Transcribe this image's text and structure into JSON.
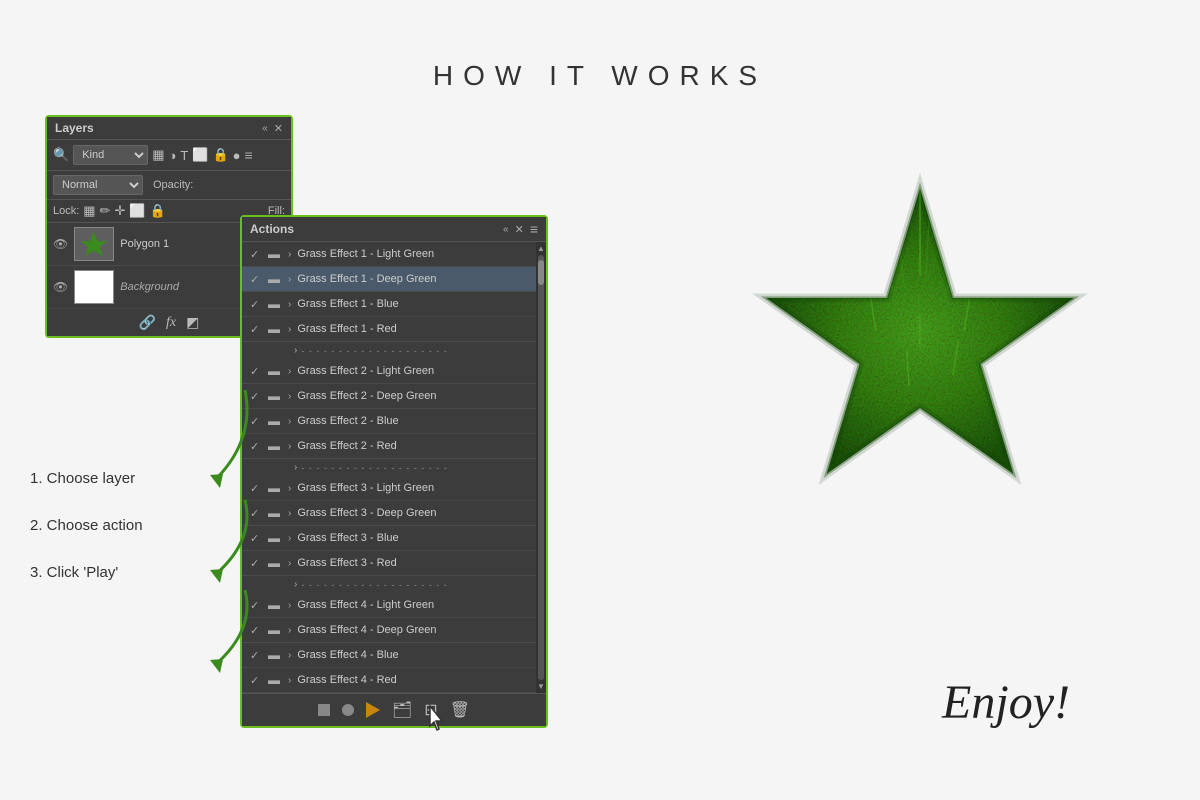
{
  "page": {
    "title": "HOW IT WORKS",
    "background_color": "#f5f5f5"
  },
  "layers_panel": {
    "title": "Layers",
    "kind_label": "Kind",
    "normal_label": "Normal",
    "opacity_label": "Opacity:",
    "lock_label": "Lock:",
    "fill_label": "Fill:",
    "layers": [
      {
        "name": "Polygon 1",
        "type": "polygon",
        "visible": true
      },
      {
        "name": "Background",
        "type": "background",
        "visible": true
      }
    ]
  },
  "actions_panel": {
    "title": "Actions",
    "items": [
      {
        "group": 1,
        "name": "Grass Effect 1 - Light Green",
        "checked": true,
        "separator": false
      },
      {
        "group": 1,
        "name": "Grass Effect 1 - Deep Green",
        "checked": true,
        "separator": false,
        "highlighted": true
      },
      {
        "group": 1,
        "name": "Grass Effect 1 - Blue",
        "checked": true,
        "separator": false
      },
      {
        "group": 1,
        "name": "Grass Effect 1 - Red",
        "checked": true,
        "separator": false
      },
      {
        "separator": true,
        "name": "---"
      },
      {
        "group": 2,
        "name": "Grass Effect 2 - Light Green",
        "checked": true,
        "separator": false
      },
      {
        "group": 2,
        "name": "Grass Effect 2 - Deep Green",
        "checked": true,
        "separator": false
      },
      {
        "group": 2,
        "name": "Grass Effect 2 - Blue",
        "checked": true,
        "separator": false
      },
      {
        "group": 2,
        "name": "Grass Effect 2 - Red",
        "checked": true,
        "separator": false
      },
      {
        "separator": true,
        "name": "---"
      },
      {
        "group": 3,
        "name": "Grass Effect 3 - Light Green",
        "checked": true,
        "separator": false
      },
      {
        "group": 3,
        "name": "Grass Effect 3 - Deep Green",
        "checked": true,
        "separator": false
      },
      {
        "group": 3,
        "name": "Grass Effect 3 - Blue",
        "checked": true,
        "separator": false
      },
      {
        "group": 3,
        "name": "Grass Effect 3 - Red",
        "checked": true,
        "separator": false
      },
      {
        "separator": true,
        "name": "---"
      },
      {
        "group": 4,
        "name": "Grass Effect 4 - Light Green",
        "checked": true,
        "separator": false
      },
      {
        "group": 4,
        "name": "Grass Effect 4 - Deep Green",
        "checked": true,
        "separator": false
      },
      {
        "group": 4,
        "name": "Grass Effect 4 - Blue",
        "checked": true,
        "separator": false
      },
      {
        "group": 4,
        "name": "Grass Effect 4 - Red",
        "checked": true,
        "separator": false
      }
    ],
    "footer_buttons": {
      "stop": "■",
      "record": "●",
      "play": "▶",
      "folder": "📁",
      "new": "📄",
      "delete": "🗑"
    }
  },
  "instructions": {
    "step1": "1. Choose layer",
    "step2": "2. Choose action",
    "step3": "3. Click 'Play'"
  },
  "enjoy_text": "Enjoy!"
}
